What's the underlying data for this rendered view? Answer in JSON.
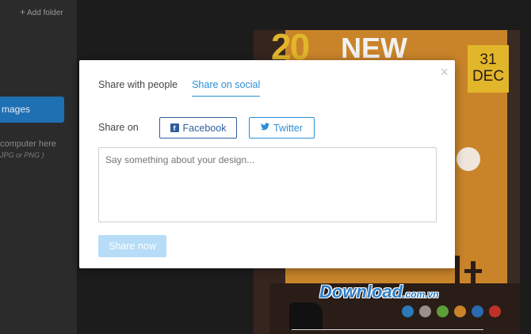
{
  "sidebar": {
    "add_folder_label": "Add folder",
    "images_label": "mages",
    "upload_line1": "computer here",
    "upload_line2": "JPG or PNG )"
  },
  "poster": {
    "number": "20",
    "headline": "NEW",
    "date_day": "31",
    "date_month": "DEC"
  },
  "watermark": {
    "brand": "Download",
    "tld": ".com.vn"
  },
  "color_dots": [
    "#2a7ab8",
    "#9a8f8a",
    "#5e9e3a",
    "#c9842a",
    "#2a6ab0",
    "#c0302a"
  ],
  "modal": {
    "close_symbol": "×",
    "tabs": [
      {
        "label": "Share with people",
        "active": false
      },
      {
        "label": "Share on social",
        "active": true
      }
    ],
    "share_on_label": "Share on",
    "facebook_label": "Facebook",
    "twitter_label": "Twitter",
    "message_placeholder": "Say something about your design...",
    "share_now_label": "Share now"
  },
  "colors": {
    "accent": "#2b8fd6",
    "facebook": "#2e5e9e",
    "share_now_disabled": "#b6dcf7"
  }
}
